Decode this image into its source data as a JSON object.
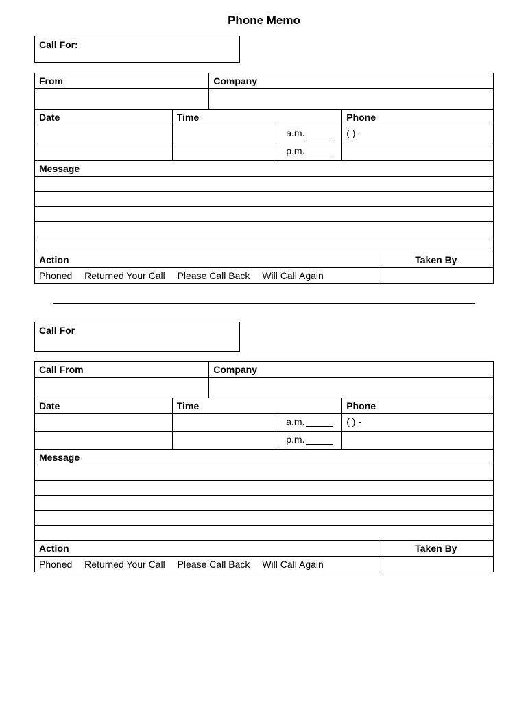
{
  "title": "Phone Memo",
  "memo1": {
    "callfor_label": "Call For:",
    "from_label": "From",
    "company_label": "Company",
    "date_label": "Date",
    "time_label": "Time",
    "phone_label": "Phone",
    "am_label": "a.m.",
    "pm_label": "p.m.",
    "phone_format": "(        )          -",
    "message_label": "Message",
    "action_label": "Action",
    "takenby_label": "Taken By",
    "action_phoned": "Phoned",
    "action_returned": "Returned Your Call",
    "action_callback": "Please Call Back",
    "action_again": "Will Call Again"
  },
  "memo2": {
    "callfor_label": "Call For",
    "from_label": "Call From",
    "company_label": "Company",
    "date_label": "Date",
    "time_label": "Time",
    "phone_label": "Phone",
    "am_label": "a.m.",
    "pm_label": "p.m.",
    "phone_format": "(        )          -",
    "message_label": "Message",
    "action_label": "Action",
    "takenby_label": "Taken By",
    "action_phoned": "Phoned",
    "action_returned": "Returned Your Call",
    "action_callback": "Please Call Back",
    "action_again": "Will Call Again"
  }
}
